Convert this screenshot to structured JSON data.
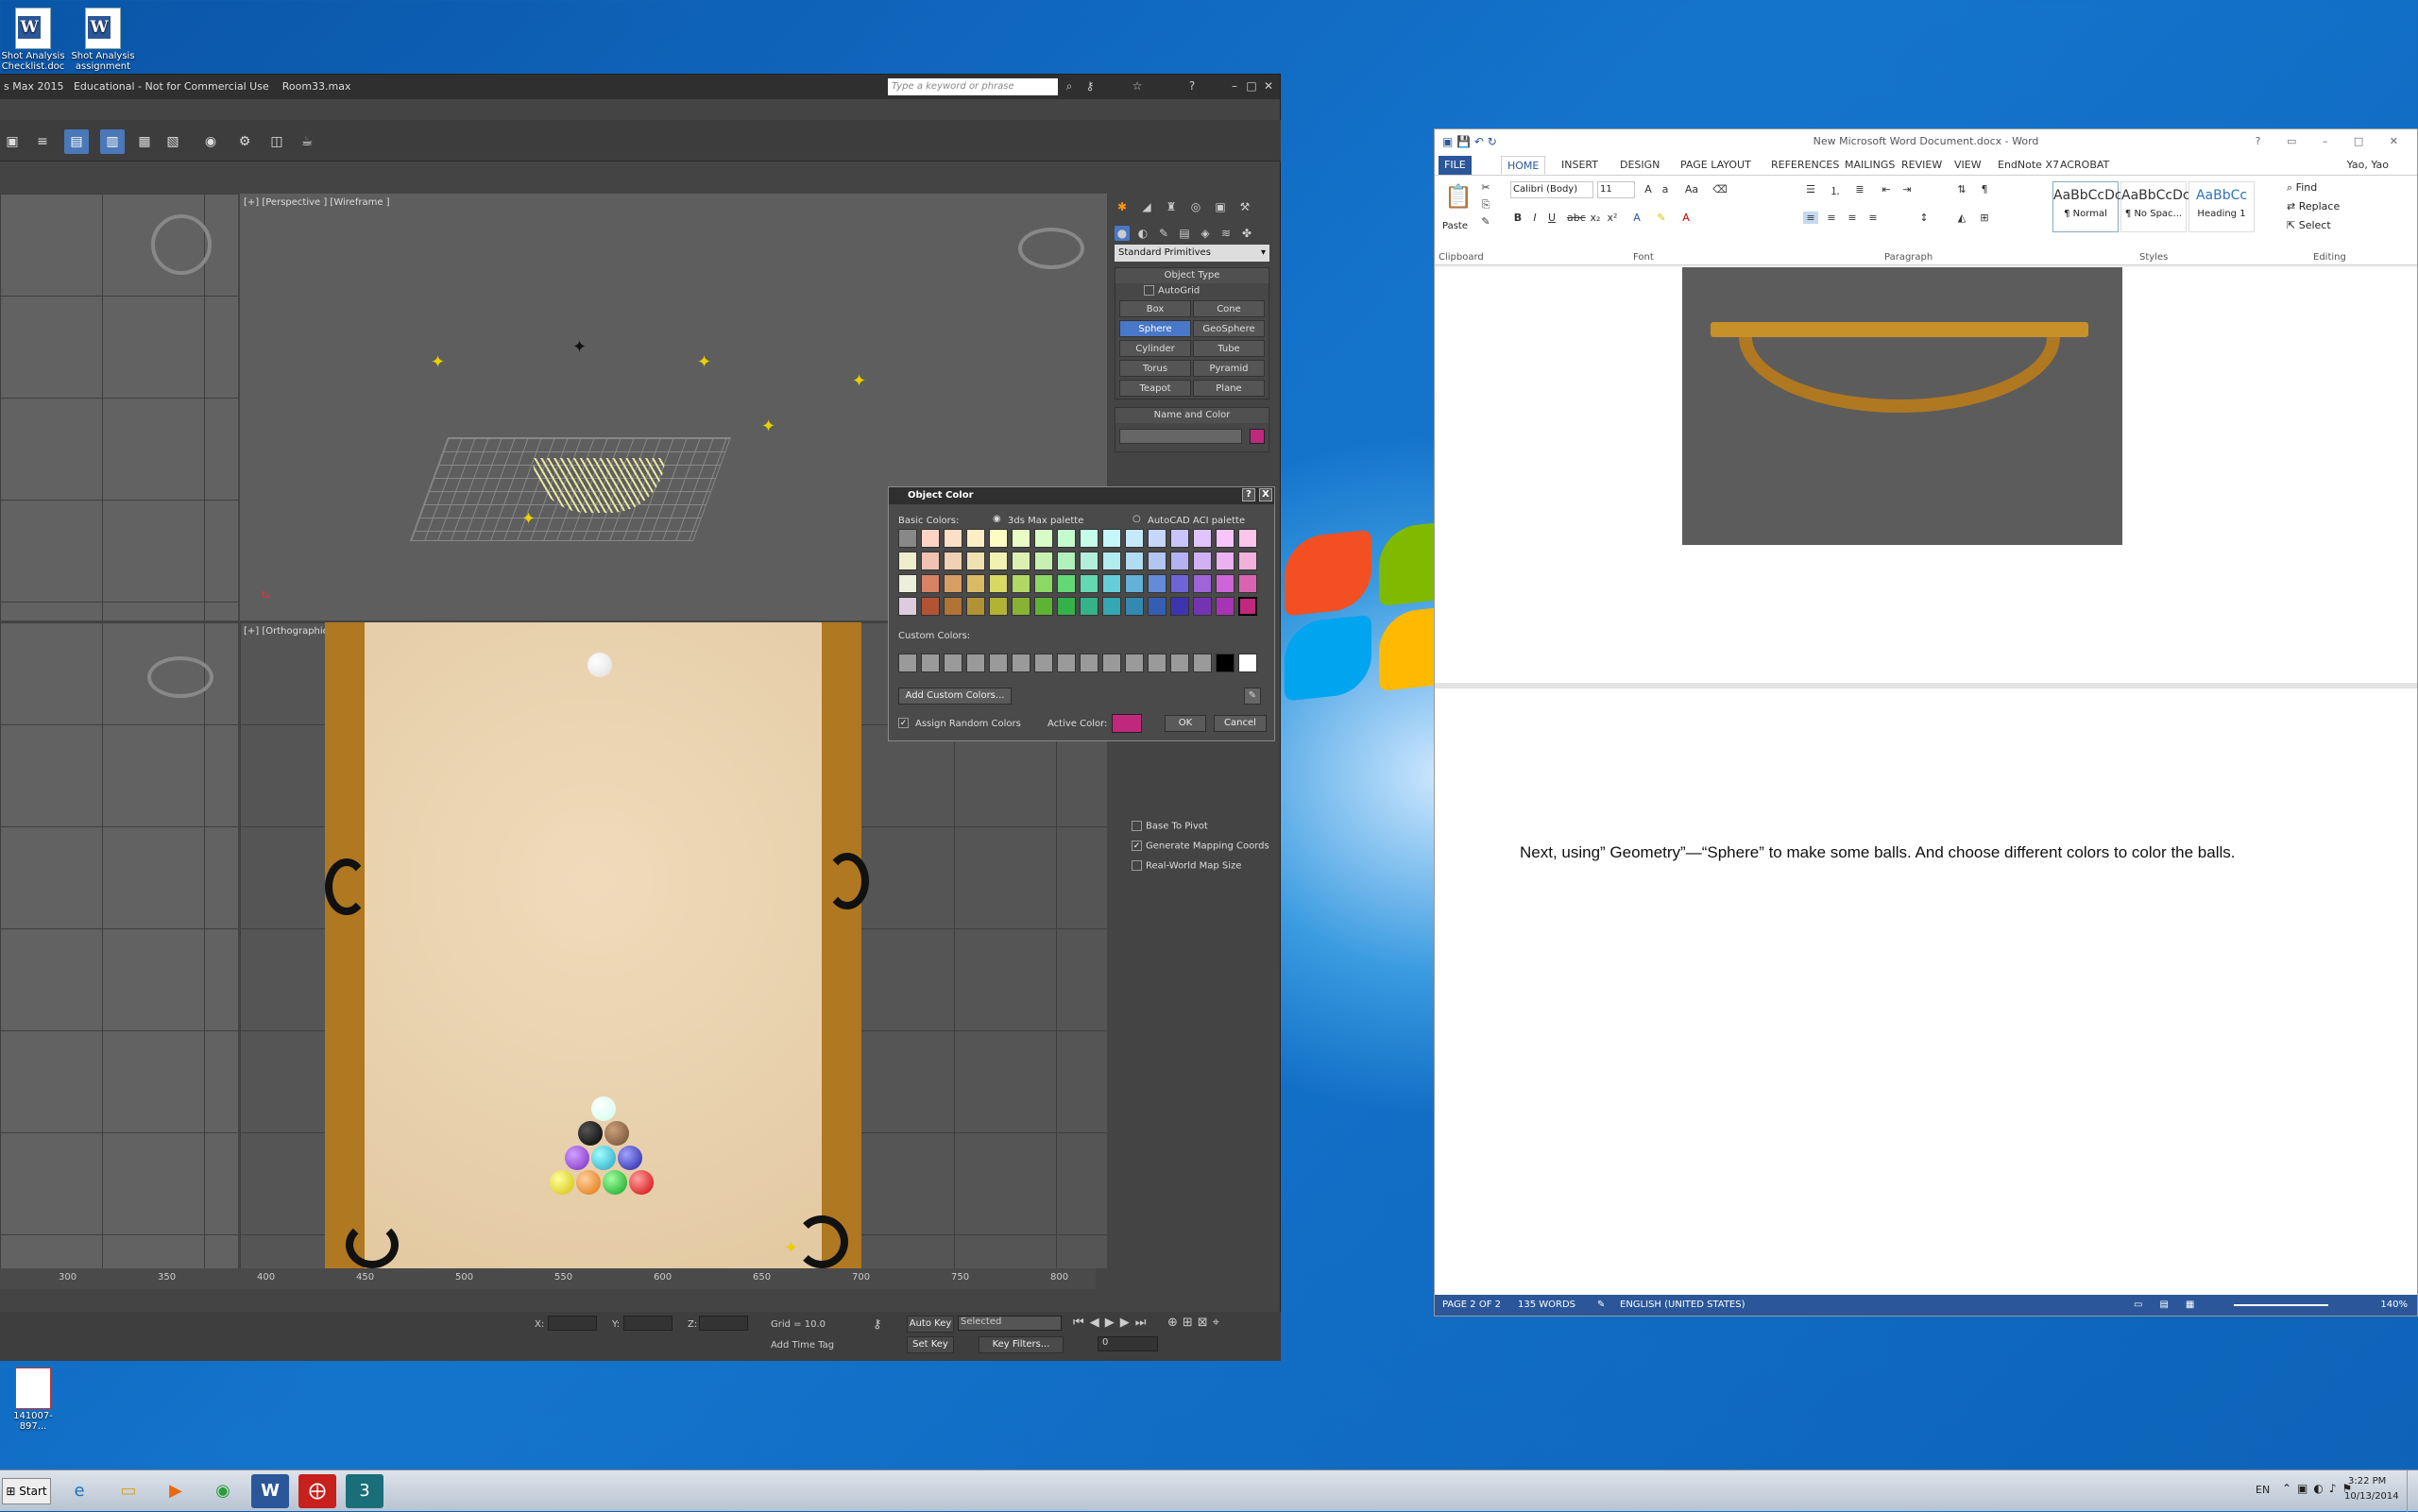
{
  "desktop": {
    "icons": [
      {
        "label": "Shot Analysis Checklist.doc"
      },
      {
        "label": "Shot Analysis assignment"
      }
    ],
    "pdf_icon": "141007-897..."
  },
  "max": {
    "title_prefix": "s Max  2015",
    "title_edu": "Educational - Not for Commercial Use",
    "title_file": "Room33.max",
    "search_placeholder": "Type a keyword or phrase",
    "vp_perspective": "[+] [Perspective ] [Wireframe ]",
    "vp_ortho": "[+] [Orthographic ] [Realis",
    "ruler": [
      "300",
      "350",
      "400",
      "450",
      "500",
      "550",
      "600",
      "650",
      "700",
      "750",
      "800"
    ],
    "grid_readout": "Grid = 10.0",
    "auto_key": "Auto Key",
    "set_key": "Set Key",
    "selected": "Selected",
    "key_filters": "Key Filters...",
    "frame": "0",
    "add_time_tag": "Add Time Tag",
    "x_label": "X:",
    "y_label": "Y:",
    "z_label": "Z:"
  },
  "cmd": {
    "dropdown": "Standard Primitives",
    "object_type": "Object Type",
    "autogrid": "AutoGrid",
    "buttons": [
      "Box",
      "Cone",
      "Sphere",
      "GeoSphere",
      "Cylinder",
      "Tube",
      "Torus",
      "Pyramid",
      "Teapot",
      "Plane"
    ],
    "name_and_color": "Name and Color",
    "base_to_pivot": "Base To Pivot",
    "gen_mapping": "Generate Mapping Coords",
    "real_world": "Real-World Map Size",
    "color_swatch": "#c0287e"
  },
  "dialog": {
    "title": "Object Color",
    "basic_colors": "Basic Colors:",
    "palette_max": "3ds Max palette",
    "palette_aci": "AutoCAD ACI palette",
    "custom_colors": "Custom Colors:",
    "add_custom": "Add Custom Colors...",
    "assign_random": "Assign Random Colors",
    "active_color": "Active Color:",
    "active_color_value": "#c0287e",
    "ok": "OK",
    "cancel": "Cancel",
    "help": "?",
    "close": "X"
  },
  "word": {
    "title": "New Microsoft Word Document.docx - Word",
    "tabs": [
      "FILE",
      "HOME",
      "INSERT",
      "DESIGN",
      "PAGE LAYOUT",
      "REFERENCES",
      "MAILINGS",
      "REVIEW",
      "VIEW",
      "EndNote X7",
      "ACROBAT"
    ],
    "user": "Yao, Yao",
    "font": "Calibri (Body)",
    "size": "11",
    "paste": "Paste",
    "groups": {
      "clipboard": "Clipboard",
      "font": "Font",
      "paragraph": "Paragraph",
      "styles": "Styles",
      "editing": "Editing"
    },
    "styles": [
      {
        "sample": "AaBbCcDc",
        "name": "¶ Normal"
      },
      {
        "sample": "AaBbCcDc",
        "name": "¶ No Spac..."
      },
      {
        "sample": "AaBbCc",
        "name": "Heading 1"
      }
    ],
    "editing": {
      "find": "Find",
      "replace": "Replace",
      "select": "Select"
    },
    "body_text": "Next, using” Geometry”—“Sphere” to make some balls. And choose different colors to color the balls.",
    "status": {
      "page": "PAGE 2 OF 2",
      "words": "135 WORDS",
      "lang": "ENGLISH (UNITED STATES)",
      "zoom": "140%"
    }
  },
  "taskbar": {
    "start": "Start",
    "lang": "EN",
    "time": "3:22 PM",
    "date": "10/13/2014"
  },
  "colors": {
    "max_bg": "#444444",
    "word_blue": "#2b579a",
    "felt": "#e8d2b0",
    "wood": "#b07820"
  }
}
